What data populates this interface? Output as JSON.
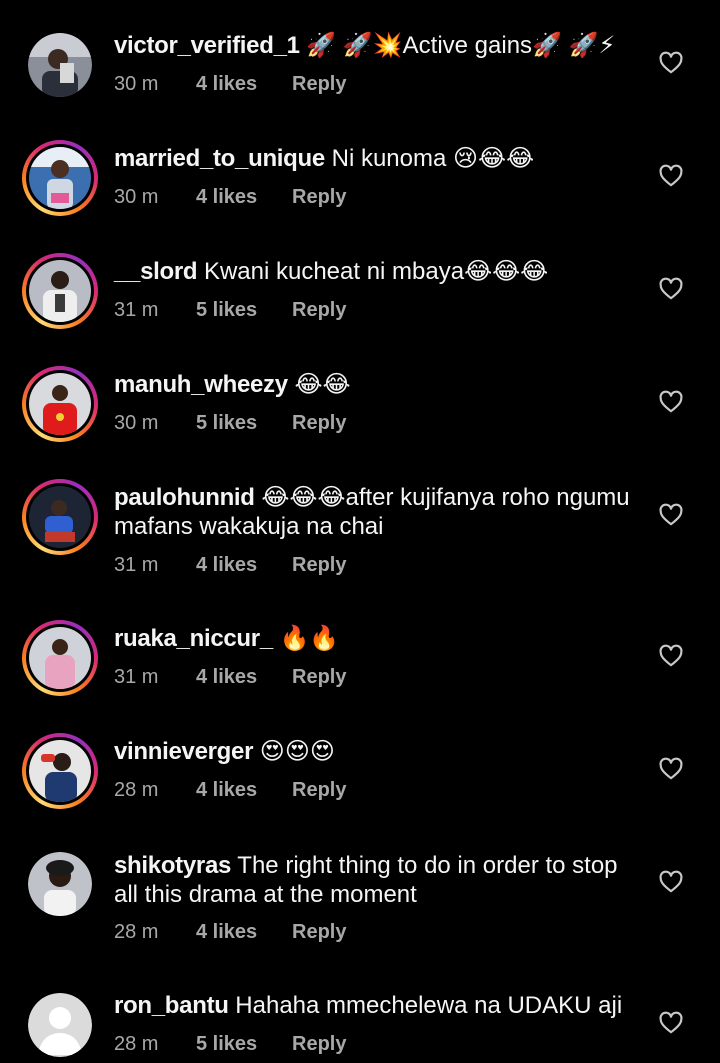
{
  "comments": [
    {
      "username": "victor_verified_1",
      "text": " 🚀 🚀💥Active gains🚀 🚀⚡",
      "time": "30 m",
      "likes": "4 likes",
      "reply": "Reply",
      "avatar": "photo",
      "ring": false
    },
    {
      "username": "married_to_unique",
      "text": " Ni kunoma 😢😂😂",
      "time": "30 m",
      "likes": "4 likes",
      "reply": "Reply",
      "avatar": "photo",
      "ring": true
    },
    {
      "username": "__slord",
      "text": " Kwani kucheat ni mbaya😂😂😂",
      "time": "31 m",
      "likes": "5 likes",
      "reply": "Reply",
      "avatar": "photo",
      "ring": true
    },
    {
      "username": "manuh_wheezy",
      "text": " 😂😂",
      "time": "30 m",
      "likes": "5 likes",
      "reply": "Reply",
      "avatar": "photo",
      "ring": true
    },
    {
      "username": "paulohunnid",
      "text": " 😂😂😂after kujifanya roho ngumu mafans wakakuja na chai",
      "time": "31 m",
      "likes": "4 likes",
      "reply": "Reply",
      "avatar": "photo",
      "ring": true
    },
    {
      "username": "ruaka_niccur_",
      "text": " 🔥🔥",
      "time": "31 m",
      "likes": "4 likes",
      "reply": "Reply",
      "avatar": "photo",
      "ring": true
    },
    {
      "username": "vinnieverger",
      "text": " 😍😍😍",
      "time": "28 m",
      "likes": "4 likes",
      "reply": "Reply",
      "avatar": "photo",
      "ring": true
    },
    {
      "username": "shikotyras",
      "text": " The right thing to do in order to stop all this drama at the moment",
      "time": "28 m",
      "likes": "4 likes",
      "reply": "Reply",
      "avatar": "photo",
      "ring": false
    },
    {
      "username": "ron_bantu",
      "text": " Hahaha mmechelewa na UDAKU aji",
      "time": "28 m",
      "likes": "5 likes",
      "reply": "Reply",
      "avatar": "default-person-icon",
      "ring": false
    }
  ],
  "colors": {
    "background": "#000000",
    "text": "#f5f5f5",
    "meta": "#a8a8a8",
    "story_ring": [
      "#feda75",
      "#fa7e1e",
      "#d62976",
      "#962fbf"
    ]
  },
  "icons": {
    "like": "heart-outline-icon"
  }
}
